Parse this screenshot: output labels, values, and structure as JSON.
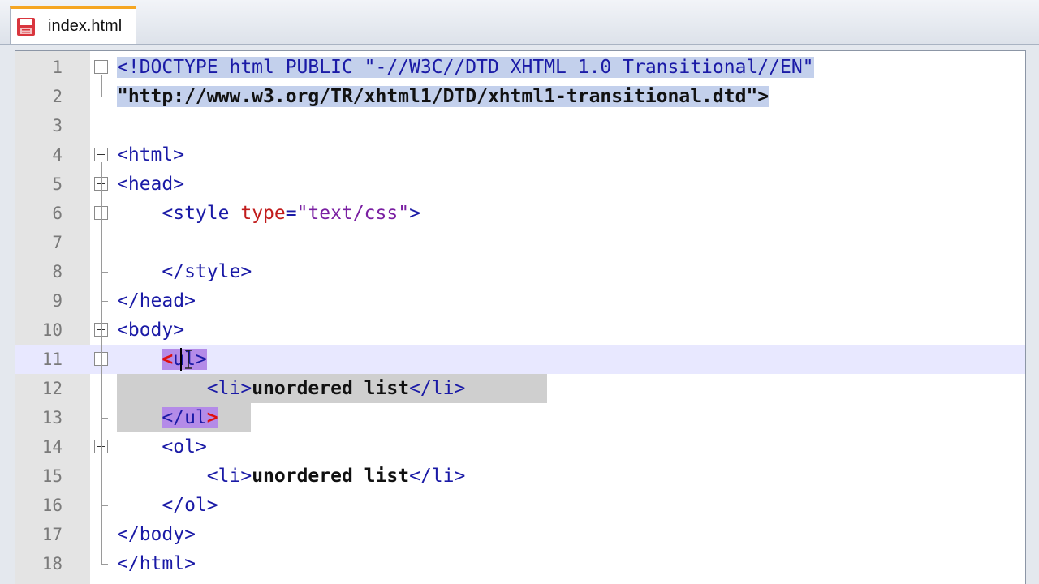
{
  "tab": {
    "label": "index.html",
    "icon": "save-file-icon"
  },
  "editor": {
    "lines": [
      {
        "n": "1",
        "text": "<!DOCTYPE html PUBLIC \"-//W3C//DTD XHTML 1.0 Transitional//EN\""
      },
      {
        "n": "2",
        "text": "\"http://www.w3.org/TR/xhtml1/DTD/xhtml1-transitional.dtd\">"
      },
      {
        "n": "3",
        "text": ""
      },
      {
        "n": "4",
        "text": "<html>"
      },
      {
        "n": "5",
        "text": "<head>"
      },
      {
        "n": "6",
        "text": "    <style type=\"text/css\">"
      },
      {
        "n": "7",
        "text": ""
      },
      {
        "n": "8",
        "text": "    </style>"
      },
      {
        "n": "9",
        "text": "</head>"
      },
      {
        "n": "10",
        "text": "<body>"
      },
      {
        "n": "11",
        "text": "    <ul>"
      },
      {
        "n": "12",
        "text": "        <li>unordered list</li>"
      },
      {
        "n": "13",
        "text": "    </ul>"
      },
      {
        "n": "14",
        "text": "    <ol>"
      },
      {
        "n": "15",
        "text": "        <li>unordered list</li>"
      },
      {
        "n": "16",
        "text": "    </ol>"
      },
      {
        "n": "17",
        "text": "</body>"
      },
      {
        "n": "18",
        "text": "</html>"
      }
    ],
    "current_line": 11
  },
  "colors": {
    "tag": "#1a1aa6",
    "attribute": "#c11c1c",
    "string": "#7a1fa2",
    "selection": "#c3d0ec",
    "brace_match": "#b48be8",
    "tab_accent": "#f5a623"
  }
}
